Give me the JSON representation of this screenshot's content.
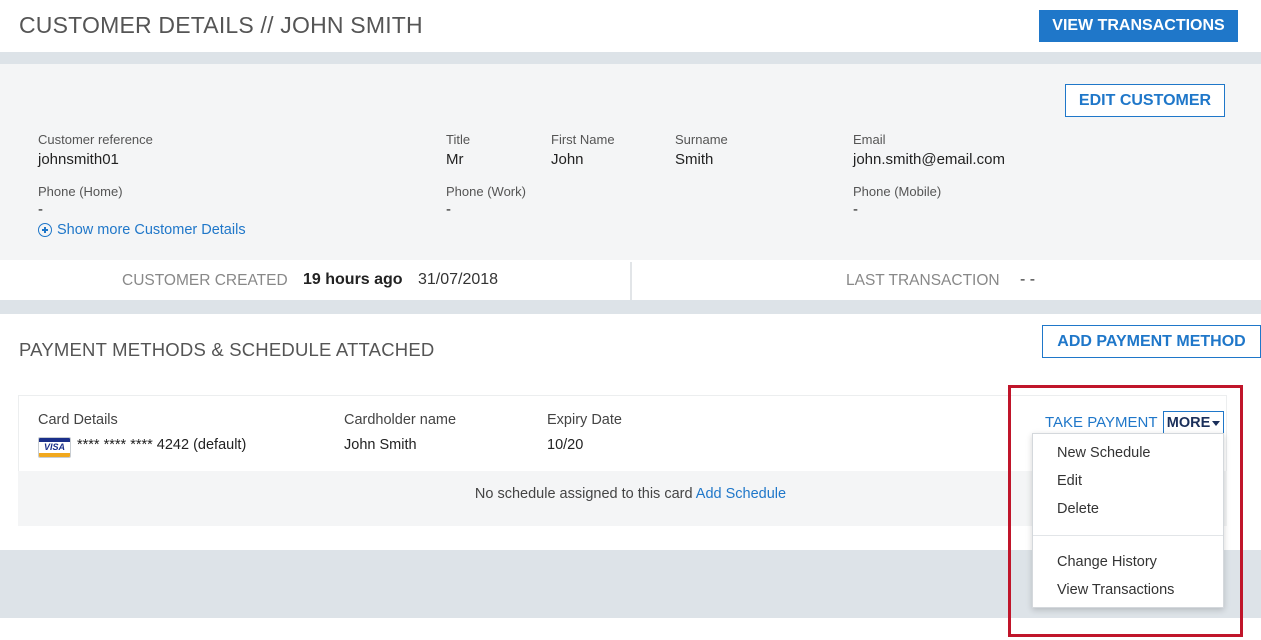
{
  "header": {
    "title": "CUSTOMER DETAILS // JOHN SMITH",
    "view_transactions_label": "VIEW TRANSACTIONS"
  },
  "customer": {
    "edit_label": "EDIT CUSTOMER",
    "fields": {
      "reference": {
        "label": "Customer reference",
        "value": "johnsmith01"
      },
      "title": {
        "label": "Title",
        "value": "Mr"
      },
      "first_name": {
        "label": "First Name",
        "value": "John"
      },
      "surname": {
        "label": "Surname",
        "value": "Smith"
      },
      "email": {
        "label": "Email",
        "value": "john.smith@email.com"
      },
      "phone_home": {
        "label": "Phone (Home)",
        "value": "-"
      },
      "phone_work": {
        "label": "Phone (Work)",
        "value": "-"
      },
      "phone_mobile": {
        "label": "Phone (Mobile)",
        "value": "-"
      }
    },
    "show_more_label": "Show more Customer Details"
  },
  "stats": {
    "created_label": "CUSTOMER CREATED",
    "created_relative": "19 hours ago",
    "created_date": "31/07/2018",
    "last_transaction_label": "LAST TRANSACTION",
    "last_transaction_value": "- -"
  },
  "payment_methods": {
    "title": "PAYMENT METHODS & SCHEDULE ATTACHED",
    "add_label": "ADD PAYMENT METHOD",
    "card": {
      "details_label": "Card Details",
      "card_brand": "VISA",
      "card_number": "**** **** **** 4242 (default)",
      "holder_label": "Cardholder name",
      "holder_value": "John Smith",
      "expiry_label": "Expiry Date",
      "expiry_value": "10/20",
      "no_schedule_text": "No schedule assigned to this card",
      "add_schedule_label": "Add Schedule",
      "take_payment_label": "TAKE PAYMENT",
      "more_label": "MORE"
    }
  },
  "more_menu": {
    "items": [
      "New Schedule",
      "Edit",
      "Delete",
      "Change History",
      "View Transactions"
    ]
  },
  "colors": {
    "accent": "#1f77c9",
    "highlight": "#c0152a",
    "band": "#dde3e8",
    "panel": "#f4f5f6"
  }
}
